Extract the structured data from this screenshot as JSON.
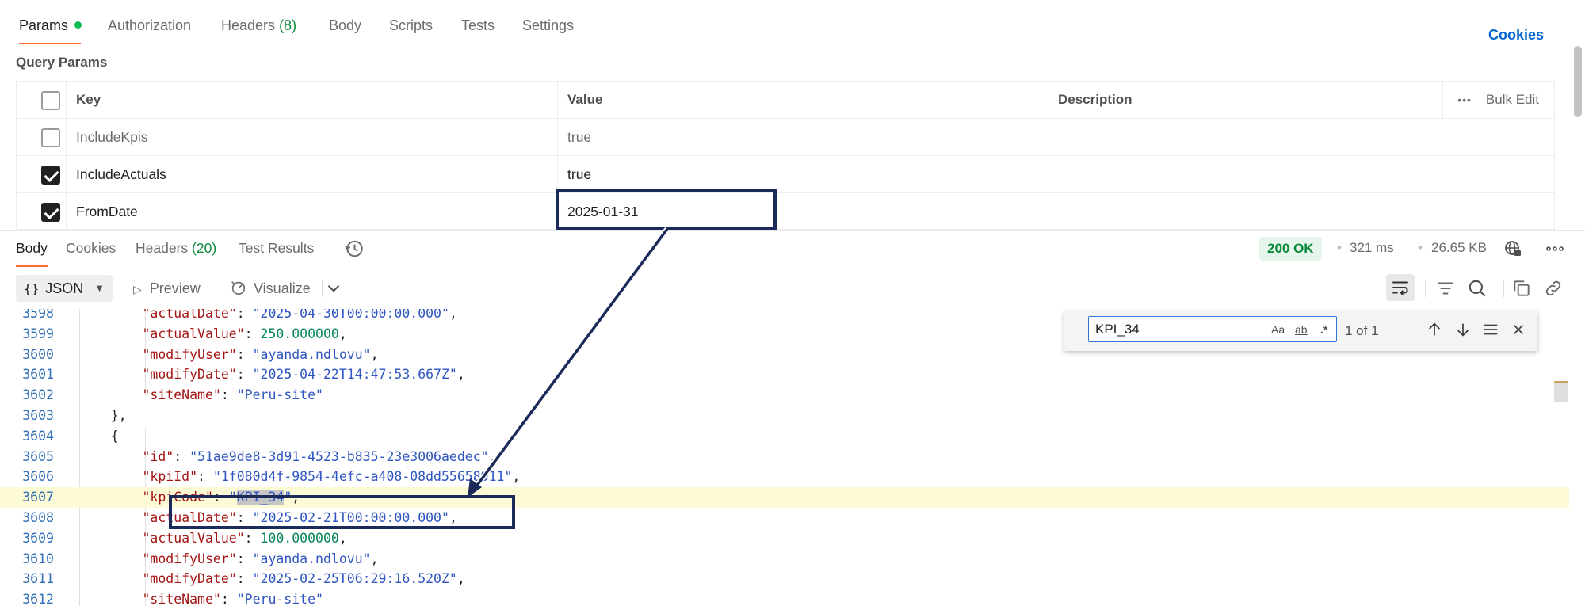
{
  "request_tabs": [
    {
      "label": "Params",
      "active": true
    },
    {
      "label": "Authorization"
    },
    {
      "label": "Headers",
      "count": "(8)"
    },
    {
      "label": "Body"
    },
    {
      "label": "Scripts"
    },
    {
      "label": "Tests"
    },
    {
      "label": "Settings"
    }
  ],
  "cookies_link": "Cookies",
  "query_params": {
    "title": "Query Params",
    "headers": {
      "key": "Key",
      "value": "Value",
      "description": "Description",
      "bulk_edit": "Bulk Edit"
    },
    "rows": [
      {
        "key": "IncludeKpis",
        "value": "true",
        "checked": false
      },
      {
        "key": "IncludeActuals",
        "value": "true",
        "checked": true
      },
      {
        "key": "FromDate",
        "value": "2025-01-31",
        "checked": true
      }
    ]
  },
  "response": {
    "tabs": [
      {
        "label": "Body",
        "active": true
      },
      {
        "label": "Cookies"
      },
      {
        "label": "Headers",
        "count": "(20)"
      },
      {
        "label": "Test Results"
      }
    ],
    "status": "200 OK",
    "time": "321 ms",
    "size": "26.65 KB"
  },
  "toolbar": {
    "format": "JSON",
    "preview": "Preview",
    "visualize": "Visualize"
  },
  "find": {
    "query": "KPI_34",
    "count": "1 of 1",
    "opt_case": "Aa",
    "opt_word": "ab",
    "opt_regex": ".*"
  },
  "code_lines": [
    {
      "n": "3598",
      "indent": "        ",
      "key": "actualDate",
      "val": "2025-04-30T00:00:00.000",
      "type": "str",
      "comma": true
    },
    {
      "n": "3599",
      "indent": "        ",
      "key": "actualValue",
      "val": "250.000000",
      "type": "num",
      "comma": true
    },
    {
      "n": "3600",
      "indent": "        ",
      "key": "modifyUser",
      "val": "ayanda.ndlovu",
      "type": "str",
      "comma": true
    },
    {
      "n": "3601",
      "indent": "        ",
      "key": "modifyDate",
      "val": "2025-04-22T14:47:53.667Z",
      "type": "str",
      "comma": true
    },
    {
      "n": "3602",
      "indent": "        ",
      "key": "siteName",
      "val": "Peru-site",
      "type": "str",
      "comma": false
    },
    {
      "n": "3603",
      "indent": "    ",
      "raw": "},"
    },
    {
      "n": "3604",
      "indent": "    ",
      "raw": "{"
    },
    {
      "n": "3605",
      "indent": "        ",
      "key": "id",
      "val": "51ae9de8-3d91-4523-b835-23e3006aedec",
      "type": "str",
      "comma": true
    },
    {
      "n": "3606",
      "indent": "        ",
      "key": "kpiId",
      "val": "1f080d4f-9854-4efc-a408-08dd55658911",
      "type": "str",
      "comma": true
    },
    {
      "n": "3607",
      "indent": "        ",
      "key": "kpiCode",
      "val": "KPI_34",
      "type": "str",
      "comma": true,
      "highlight": true
    },
    {
      "n": "3608",
      "indent": "        ",
      "key": "actualDate",
      "val": "2025-02-21T00:00:00.000",
      "type": "str",
      "comma": true
    },
    {
      "n": "3609",
      "indent": "        ",
      "key": "actualValue",
      "val": "100.000000",
      "type": "num",
      "comma": true
    },
    {
      "n": "3610",
      "indent": "        ",
      "key": "modifyUser",
      "val": "ayanda.ndlovu",
      "type": "str",
      "comma": true
    },
    {
      "n": "3611",
      "indent": "        ",
      "key": "modifyDate",
      "val": "2025-02-25T06:29:16.520Z",
      "type": "str",
      "comma": true
    },
    {
      "n": "3612",
      "indent": "        ",
      "key": "siteName",
      "val": "Peru-site",
      "type": "str",
      "comma": false
    }
  ],
  "colors": {
    "accent": "#ff6c37",
    "status_ok": "#0b8a3c",
    "annotation": "#1c2a5a",
    "link": "#0265d2"
  }
}
